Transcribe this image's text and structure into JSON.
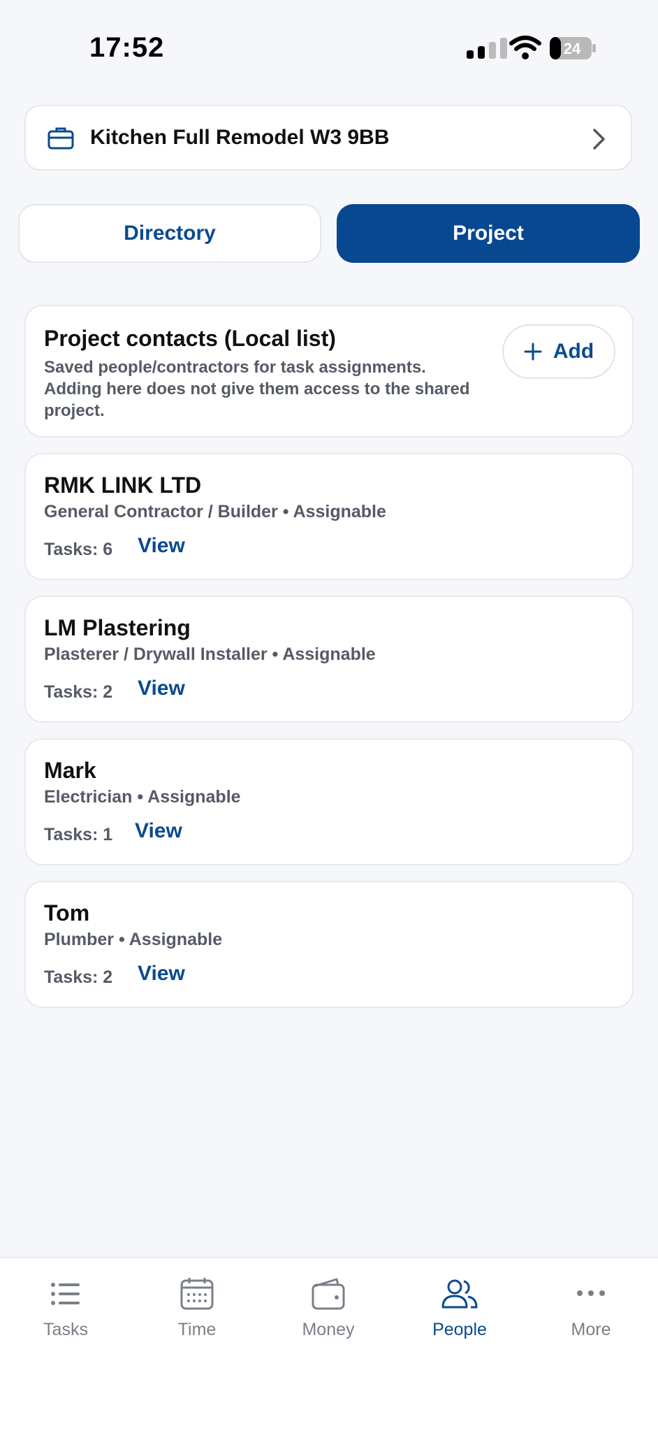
{
  "status": {
    "time": "17:52",
    "battery": "24"
  },
  "project": {
    "title": "Kitchen Full Remodel W3 9BB"
  },
  "tabs": [
    {
      "label": "Directory",
      "active": false
    },
    {
      "label": "Project",
      "active": true
    }
  ],
  "contacts_header": {
    "title": "Project contacts (Local list)",
    "description": "Saved people/contractors for task assignments. Adding here does not give them access to the shared project.",
    "add_label": "Add"
  },
  "contacts": [
    {
      "name": "RMK LINK LTD",
      "meta": "General Contractor / Builder • Assignable",
      "tasks": "Tasks: 6",
      "view_label": "View"
    },
    {
      "name": "LM Plastering",
      "meta": "Plasterer / Drywall Installer • Assignable",
      "tasks": "Tasks: 2",
      "view_label": "View"
    },
    {
      "name": "Mark",
      "meta": "Electrician • Assignable",
      "tasks": "Tasks: 1",
      "view_label": "View"
    },
    {
      "name": "Tom",
      "meta": "Plumber • Assignable",
      "tasks": "Tasks: 2",
      "view_label": "View"
    }
  ],
  "nav": [
    {
      "label": "Tasks",
      "icon": "list-icon",
      "active": false
    },
    {
      "label": "Time",
      "icon": "calendar-icon",
      "active": false
    },
    {
      "label": "Money",
      "icon": "wallet-icon",
      "active": false
    },
    {
      "label": "People",
      "icon": "people-icon",
      "active": true
    },
    {
      "label": "More",
      "icon": "more-icon",
      "active": false
    }
  ],
  "colors": {
    "primary": "#074891",
    "text_muted": "#555a66",
    "background": "#f6f7fb"
  }
}
